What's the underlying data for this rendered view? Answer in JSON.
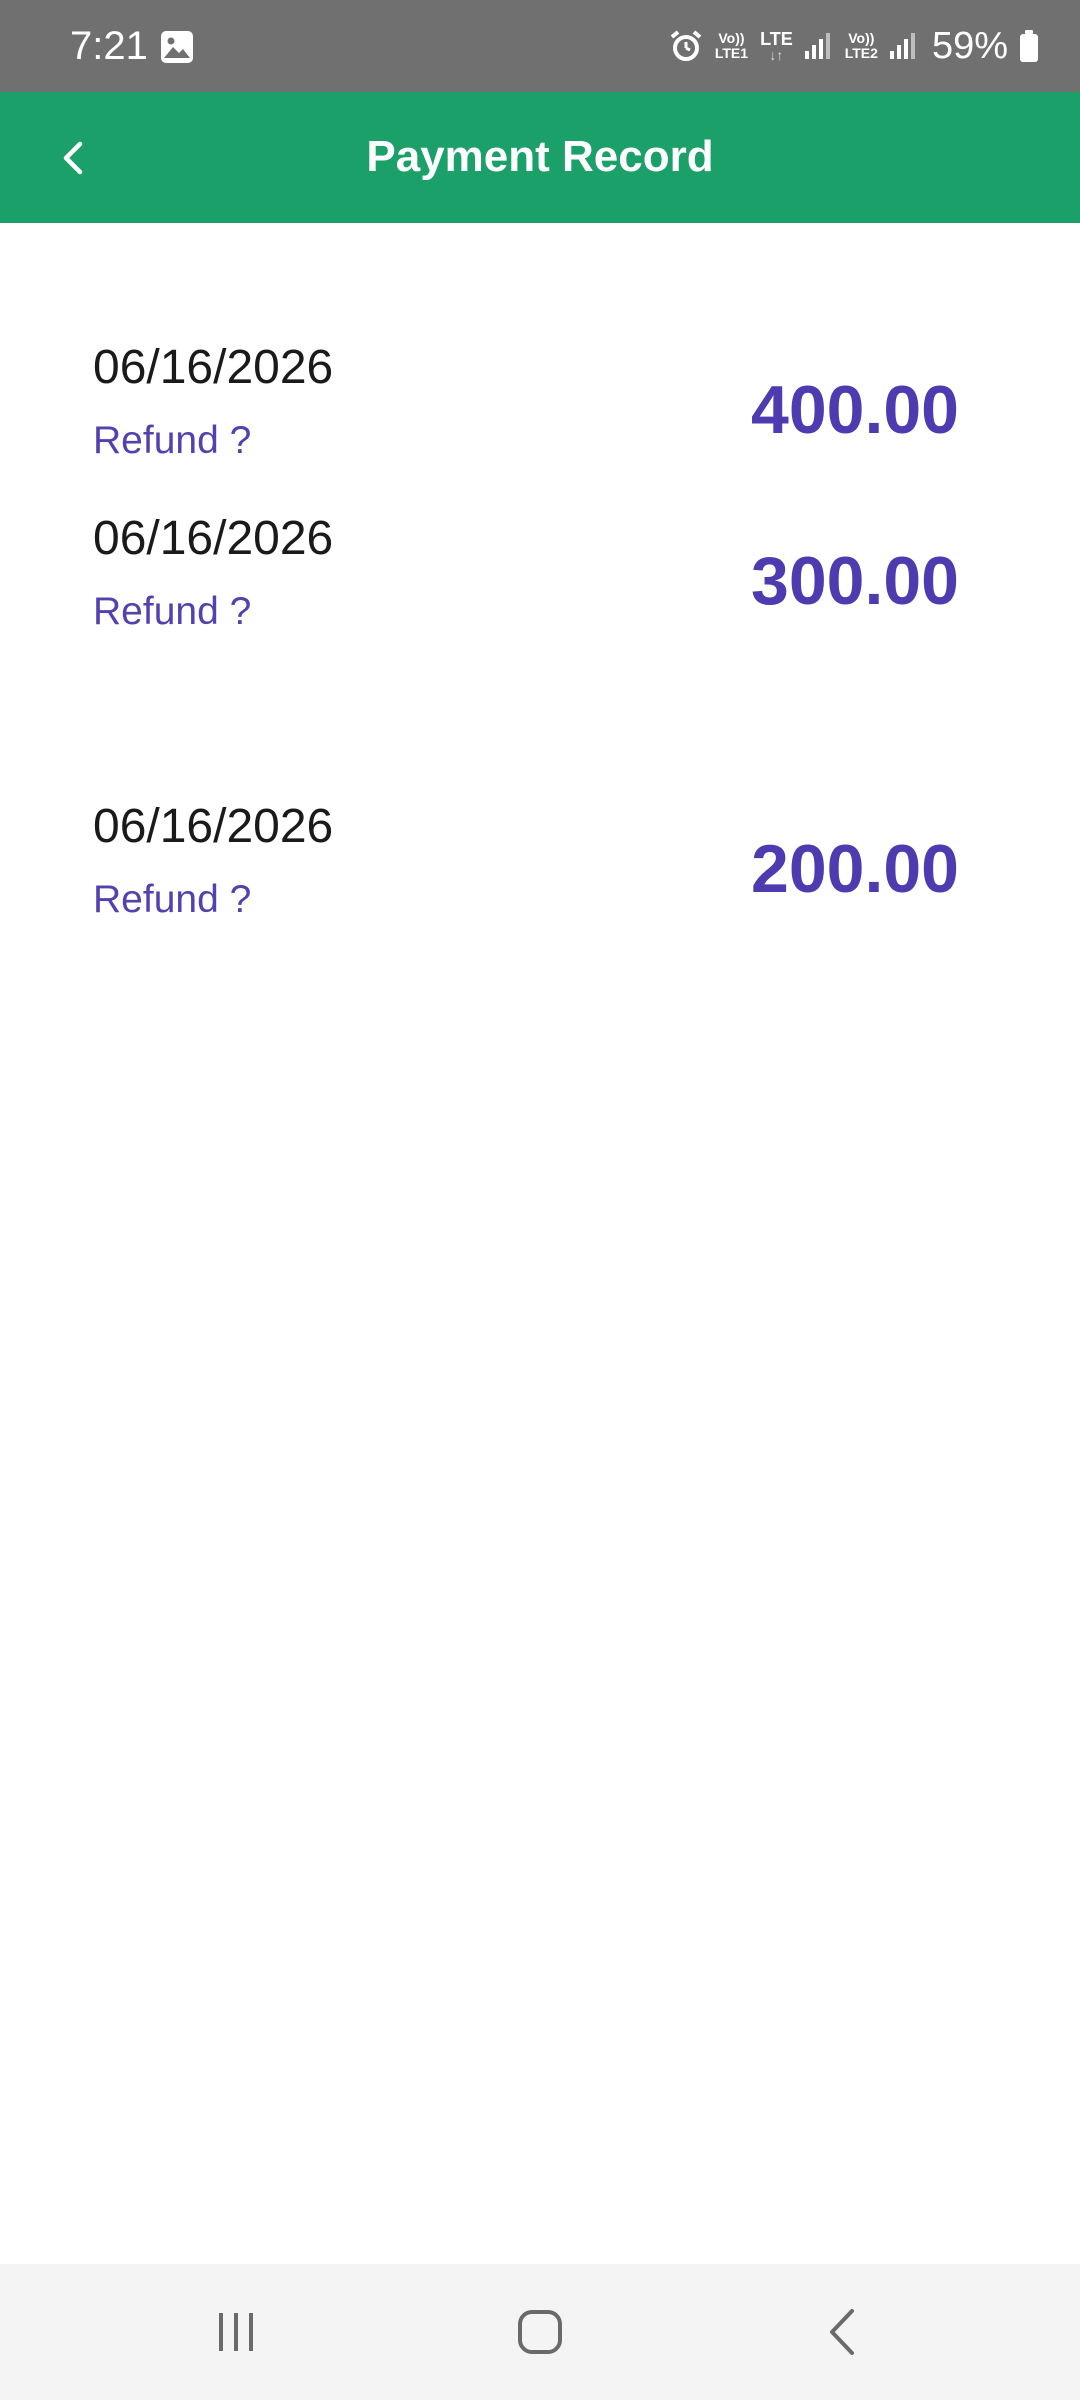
{
  "status_bar": {
    "time": "7:21",
    "sim1_top": "Vo))",
    "sim1_bottom": "LTE1",
    "data_type": "LTE",
    "data_arrows": "↓↑",
    "sim2_top": "Vo))",
    "sim2_bottom": "LTE2",
    "battery": "59%",
    "icons": [
      "gallery-icon",
      "alarm-icon",
      "signal-icon",
      "battery-icon"
    ]
  },
  "app_bar": {
    "title": "Payment Record",
    "back_icon": "chevron-left-icon",
    "color": "#1ba06a"
  },
  "payments": [
    {
      "date": "06/16/2026",
      "refund_label": "Refund ?",
      "amount": "400.00"
    },
    {
      "date": "06/16/2026",
      "refund_label": "Refund ?",
      "amount": "300.00"
    },
    {
      "date": "06/16/2026",
      "refund_label": "Refund ?",
      "amount": "200.00"
    }
  ],
  "nav_bar": {
    "icons": [
      "recent-apps-icon",
      "home-icon",
      "back-icon"
    ]
  },
  "colors": {
    "accent_green": "#1ba06a",
    "amount_purple": "#4e3bb0",
    "link_purple": "#5540b0",
    "status_bar_gray": "#707070"
  }
}
